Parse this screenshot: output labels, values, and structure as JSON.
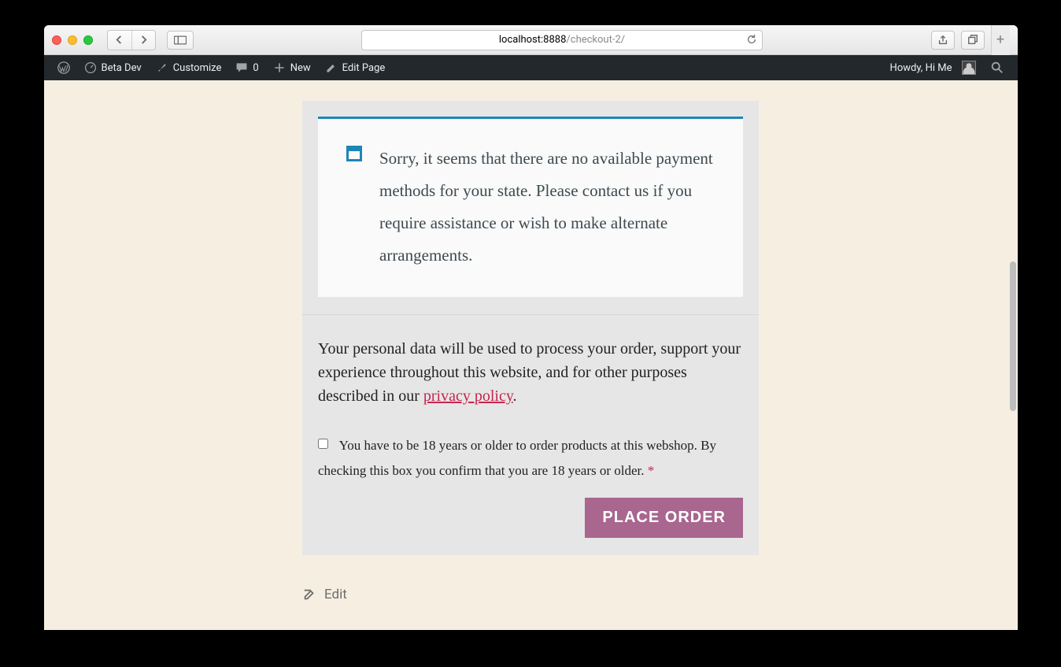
{
  "browser": {
    "url_host": "localhost:8888",
    "url_path": "/checkout-2/"
  },
  "wp_admin": {
    "site_name": "Beta Dev",
    "customize": "Customize",
    "comments_count": "0",
    "new_label": "New",
    "edit_page": "Edit Page",
    "howdy": "Howdy, Hi Me"
  },
  "checkout": {
    "notice": "Sorry, it seems that there are no available payment methods for your state. Please contact us if you require assistance or wish to make alternate arrangements.",
    "privacy_pre": "Your personal data will be used to process your order, support your experience throughout this website, and for other purposes described in our ",
    "privacy_link": "privacy policy",
    "privacy_post": ".",
    "age_text": "You have to be 18 years or older to order products at this webshop. By checking this box you confirm that you are 18 years or older. ",
    "required_mark": "*",
    "place_order": "PLACE ORDER"
  },
  "footer": {
    "edit": "Edit"
  }
}
